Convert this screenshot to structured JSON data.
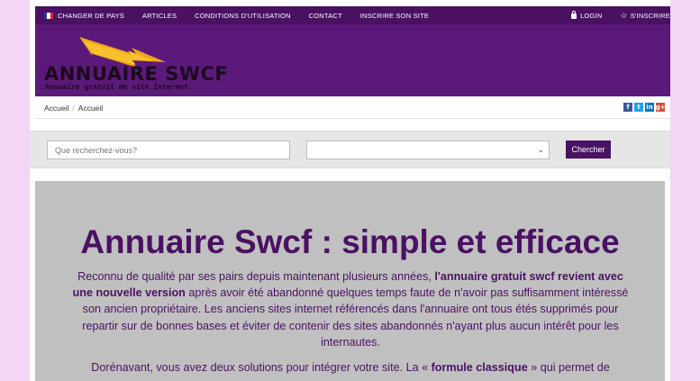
{
  "nav": {
    "items": [
      {
        "label": "CHANGER DE PAYS",
        "icon": "flag-france-icon"
      },
      {
        "label": "ARTICLES"
      },
      {
        "label": "CONDITIONS D'UTILISATION"
      },
      {
        "label": "CONTACT"
      },
      {
        "label": "INSCRIRE SON SITE"
      }
    ],
    "login_label": "LOGIN",
    "signup_label": "S'INSCRIRE"
  },
  "logo": {
    "title": "ANNUAIRE SWCF",
    "subtitle": "Annuaire gratuit de site Internet"
  },
  "breadcrumb": [
    "Accueil",
    "Accueil"
  ],
  "social": [
    {
      "name": "facebook-icon",
      "glyph": "f",
      "color": "#3b5998"
    },
    {
      "name": "twitter-icon",
      "glyph": "t",
      "color": "#1da1f2"
    },
    {
      "name": "linkedin-icon",
      "glyph": "in",
      "color": "#0e76a8"
    },
    {
      "name": "google-plus-icon",
      "glyph": "g+",
      "color": "#dd4b39"
    }
  ],
  "search": {
    "placeholder": "Que recherchez-vous?",
    "select_value": "",
    "button_label": "Chercher"
  },
  "hero": {
    "title": "Annuaire Swcf : simple et efficace",
    "p1_a": "Reconnu de qualité par ses pairs depuis maintenant plusieurs années, ",
    "p1_b": "l'annuaire gratuit swcf revient avec une nouvelle version",
    "p1_c": " après avoir été abandonné quelques temps faute de n'avoir pas suffisamment intéressé son ancien propriétaire. Les anciens sites internet référencés dans l'annuaire ont tous étés supprimés pour repartir sur de bonnes bases et éviter de contenir des sites abandonnés n'ayant plus aucun intérêt pour les internautes.",
    "p2_a": "Dorénavant, vous avez deux solutions pour intégrer votre site. La « ",
    "p2_b": "formule classique",
    "p2_c": " » qui permet de"
  },
  "colors": {
    "brand": "#4a1163",
    "banner": "#5b1a7a",
    "background": "#f2d6f4",
    "hero_bg": "#c0c0c0"
  }
}
